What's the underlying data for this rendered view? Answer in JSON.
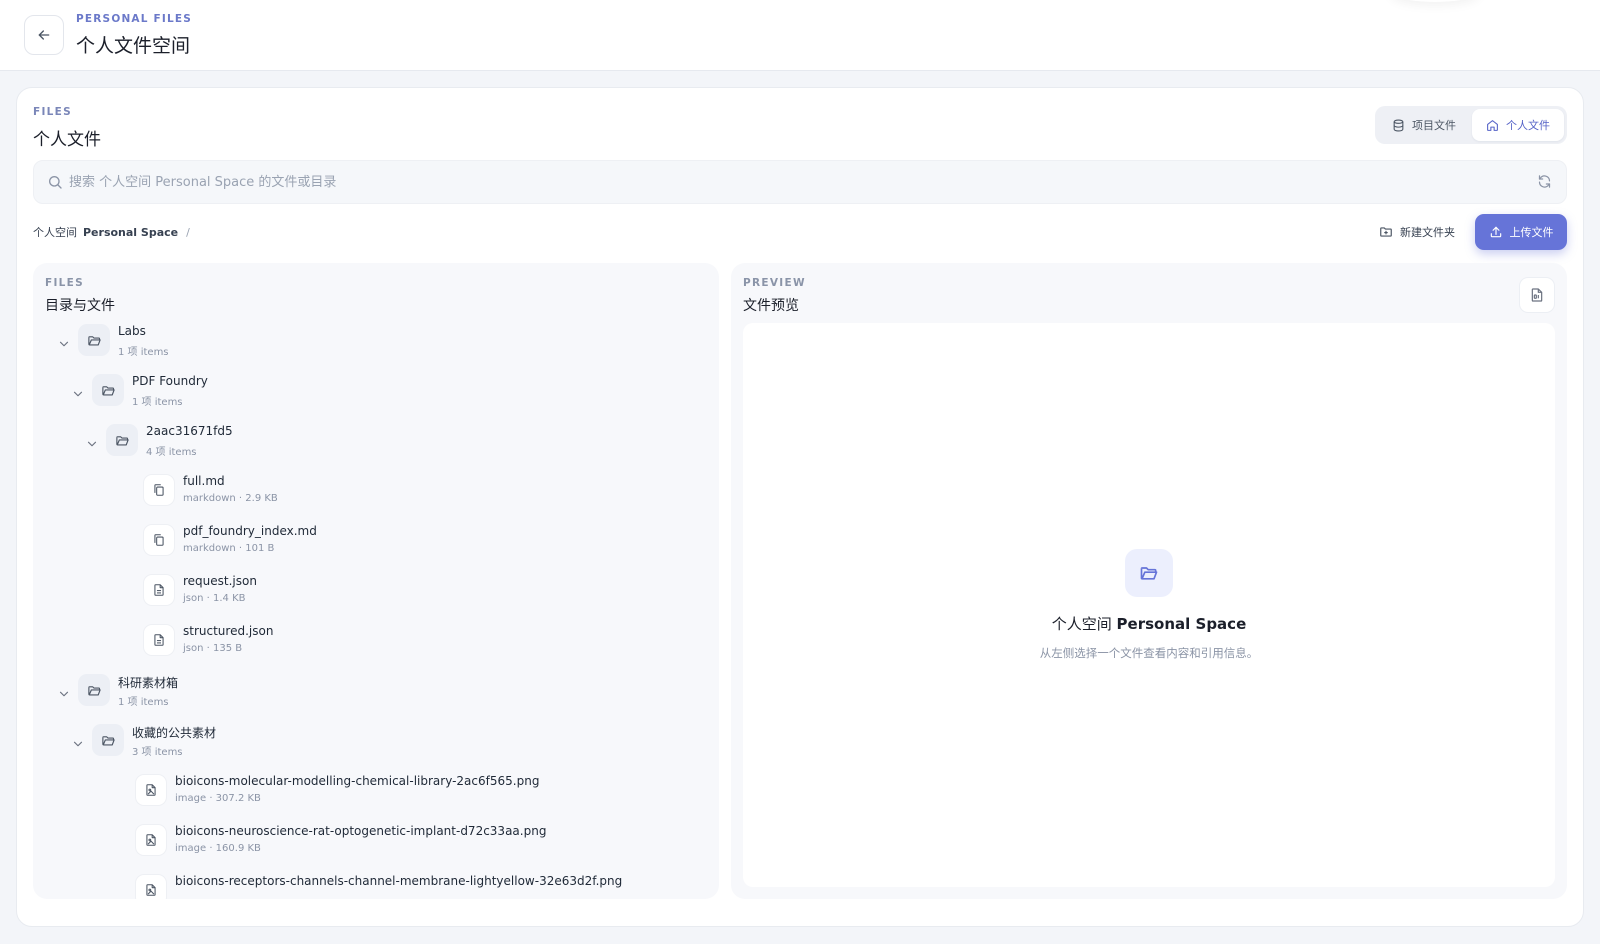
{
  "header": {
    "eyebrow": "PERSONAL FILES",
    "title": "个人文件空间"
  },
  "files_header": {
    "eyebrow": "FILES",
    "title": "个人文件"
  },
  "scope_tabs": [
    {
      "label": "项目文件",
      "icon": "database-icon",
      "active": false
    },
    {
      "label": "个人文件",
      "icon": "home-icon",
      "active": true
    }
  ],
  "search": {
    "placeholder": "搜索 个人空间 Personal Space 的文件或目录",
    "value": ""
  },
  "breadcrumb": {
    "prefix": "个人空间",
    "current": "Personal Space",
    "separator": "/"
  },
  "actions": {
    "new_folder": "新建文件夹",
    "upload": "上传文件"
  },
  "tree_panel": {
    "eyebrow": "FILES",
    "title": "目录与文件",
    "items": [
      {
        "kind": "folder",
        "name": "Labs",
        "meta": "1 项 items",
        "depth": 0,
        "expanded": true
      },
      {
        "kind": "folder",
        "name": "PDF Foundry",
        "meta": "1 项 items",
        "depth": 1,
        "expanded": true
      },
      {
        "kind": "folder",
        "name": "2aac31671fd5",
        "meta": "4 项 items",
        "depth": 2,
        "expanded": true
      },
      {
        "kind": "markdown",
        "name": "full.md",
        "meta": "markdown · 2.9 KB",
        "depth": 3
      },
      {
        "kind": "markdown",
        "name": "pdf_foundry_index.md",
        "meta": "markdown · 101 B",
        "depth": 3
      },
      {
        "kind": "json",
        "name": "request.json",
        "meta": "json · 1.4 KB",
        "depth": 3
      },
      {
        "kind": "json",
        "name": "structured.json",
        "meta": "json · 135 B",
        "depth": 3
      },
      {
        "kind": "folder",
        "name": "科研素材箱",
        "meta": "1 项 items",
        "depth": 0,
        "expanded": true
      },
      {
        "kind": "folder",
        "name": "收藏的公共素材",
        "meta": "3 项 items",
        "depth": 1,
        "expanded": true
      },
      {
        "kind": "image",
        "name": "bioicons-molecular-modelling-chemical-library-2ac6f565.png",
        "meta": "image · 307.2 KB",
        "depth": 2
      },
      {
        "kind": "image",
        "name": "bioicons-neuroscience-rat-optogenetic-implant-d72c33aa.png",
        "meta": "image · 160.9 KB",
        "depth": 2
      },
      {
        "kind": "image",
        "name": "bioicons-receptors-channels-channel-membrane-lightyellow-32e63d2f.png",
        "meta": "",
        "depth": 2
      }
    ]
  },
  "preview_panel": {
    "eyebrow": "PREVIEW",
    "title": "文件预览",
    "empty_title_prefix": "个人空间",
    "empty_title_strong": "Personal Space",
    "empty_subtitle": "从左侧选择一个文件查看内容和引用信息。"
  },
  "colors": {
    "accent": "#6674d8",
    "accent_text": "#5663c7",
    "eyebrow": "#6b79c9",
    "muted": "#8b94a6"
  }
}
